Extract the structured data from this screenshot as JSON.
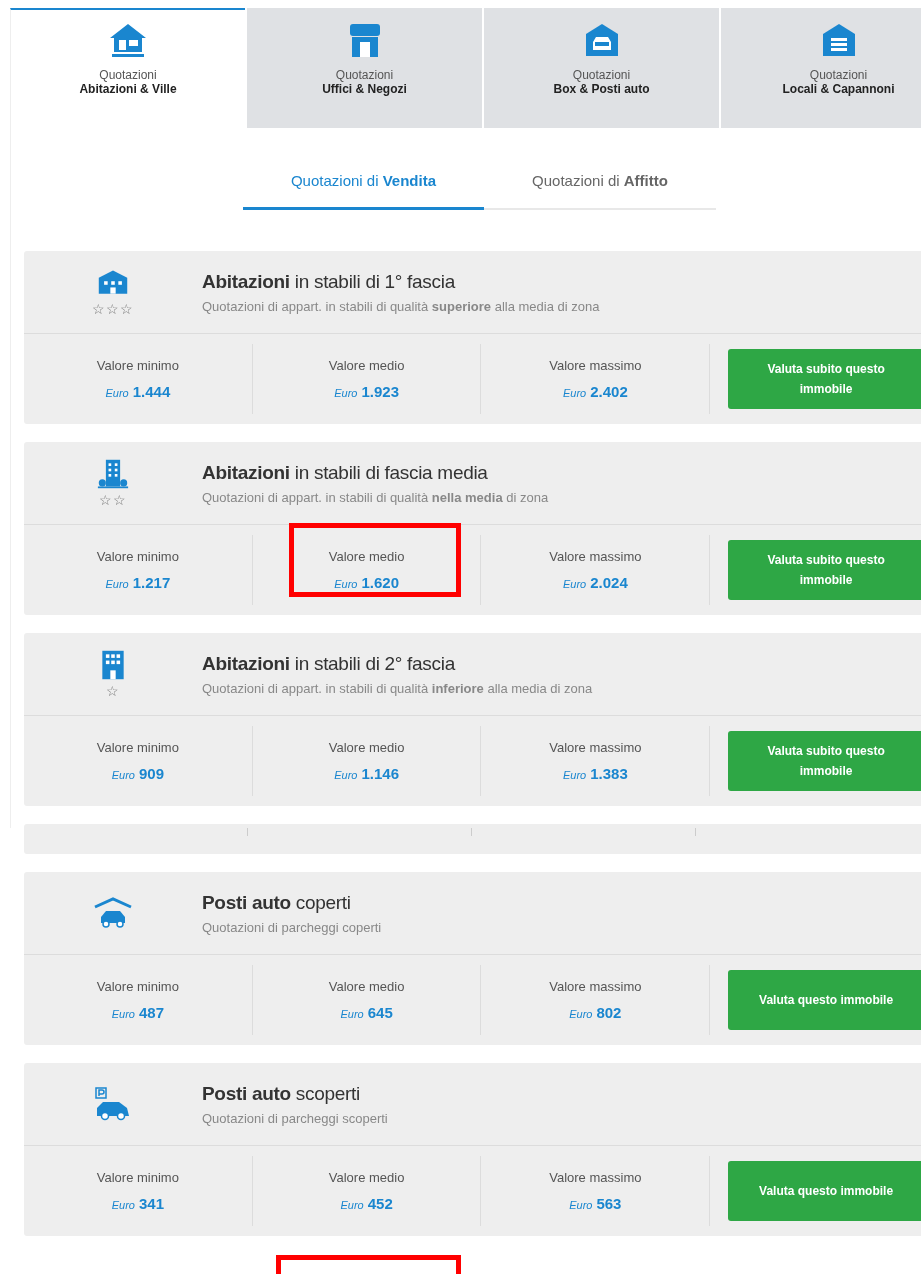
{
  "tabs": [
    {
      "kind": "house",
      "line1": "Quotazioni",
      "line2": "Abitazioni & Ville",
      "selected": true
    },
    {
      "kind": "shop",
      "line1": "Quotazioni",
      "line2": "Uffici & Negozi",
      "selected": false
    },
    {
      "kind": "garage",
      "line1": "Quotazioni",
      "line2": "Box & Posti auto",
      "selected": false
    },
    {
      "kind": "warehouse",
      "line1": "Quotazioni",
      "line2": "Locali & Capannoni",
      "selected": false
    }
  ],
  "subtabs": [
    {
      "label": "Quotazioni di **Vendita**",
      "selected": true
    },
    {
      "label": "Quotazioni di **Affitto**",
      "selected": false
    }
  ],
  "cards": [
    {
      "kind": "mansion",
      "stars": "☆☆☆",
      "title": "**Abitazioni** in stabili di 1° fascia",
      "subtitle": "Quotazioni di appart. in stabili di qualità **superiore** alla media di zona",
      "values": [
        {
          "label": "Valore minimo",
          "currency": "Euro",
          "amount": "1.444",
          "highlighted": false
        },
        {
          "label": "Valore medio",
          "currency": "Euro",
          "amount": "1.923",
          "highlighted": false
        },
        {
          "label": "Valore massimo",
          "currency": "Euro",
          "amount": "2.402",
          "highlighted": false
        }
      ],
      "button": "Valuta subito questo immobile"
    },
    {
      "kind": "tower",
      "stars": "☆☆",
      "title": "**Abitazioni** in stabili di fascia media",
      "subtitle": "Quotazioni di appart. in stabili di qualità **nella media** di zona",
      "values": [
        {
          "label": "Valore minimo",
          "currency": "Euro",
          "amount": "1.217",
          "highlighted": false
        },
        {
          "label": "Valore medio",
          "currency": "Euro",
          "amount": "1.620",
          "highlighted": true
        },
        {
          "label": "Valore massimo",
          "currency": "Euro",
          "amount": "2.024",
          "highlighted": false
        }
      ],
      "button": "Valuta subito questo immobile"
    },
    {
      "kind": "building",
      "stars": "☆",
      "title": "**Abitazioni** in stabili di 2° fascia",
      "subtitle": "Quotazioni di appart. in stabili di qualità **inferiore** alla media di zona",
      "values": [
        {
          "label": "Valore minimo",
          "currency": "Euro",
          "amount": "909",
          "highlighted": false
        },
        {
          "label": "Valore medio",
          "currency": "Euro",
          "amount": "1.146",
          "highlighted": false
        },
        {
          "label": "Valore massimo",
          "currency": "Euro",
          "amount": "1.383",
          "highlighted": false
        }
      ],
      "button": "Valuta subito questo immobile"
    },
    {
      "kind": "blank"
    },
    {
      "kind": "covered-car",
      "title": "**Posti auto** coperti",
      "subtitle": "Quotazioni di parcheggi coperti",
      "values": [
        {
          "label": "Valore minimo",
          "currency": "Euro",
          "amount": "487",
          "highlighted": false
        },
        {
          "label": "Valore medio",
          "currency": "Euro",
          "amount": "645",
          "highlighted": false
        },
        {
          "label": "Valore massimo",
          "currency": "Euro",
          "amount": "802",
          "highlighted": false
        }
      ],
      "button": "Valuta questo immobile"
    },
    {
      "kind": "parking-car",
      "title": "**Posti auto** scoperti",
      "subtitle": "Quotazioni di parcheggi scoperti",
      "values": [
        {
          "label": "Valore minimo",
          "currency": "Euro",
          "amount": "341",
          "highlighted": false
        },
        {
          "label": "Valore medio",
          "currency": "Euro",
          "amount": "452",
          "highlighted": false
        },
        {
          "label": "Valore massimo",
          "currency": "Euro",
          "amount": "563",
          "highlighted": false
        }
      ],
      "button": "Valuta questo immobile"
    }
  ],
  "bottom_frame": true
}
